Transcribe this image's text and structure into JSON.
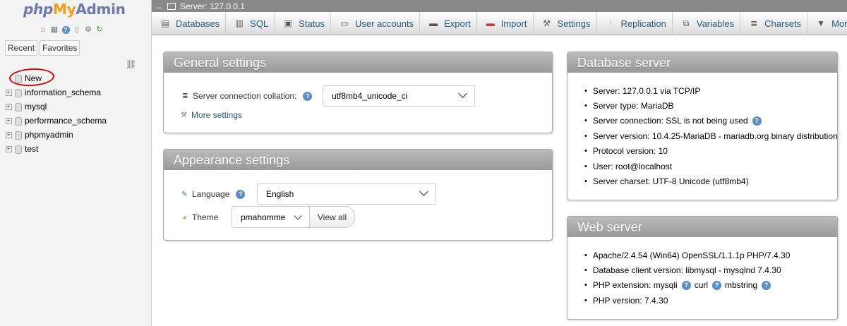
{
  "nav": {
    "logo": {
      "php": "php",
      "my": "My",
      "admin": "Admin"
    },
    "quick_icons": [
      "home-icon",
      "logout-icon",
      "help-icon",
      "docs-icon",
      "settings-icon",
      "reload-icon"
    ],
    "tabs": {
      "recent": "Recent",
      "favorites": "Favorites"
    },
    "tree": [
      {
        "name": "New",
        "new": true
      },
      {
        "name": "information_schema"
      },
      {
        "name": "mysql"
      },
      {
        "name": "performance_schema"
      },
      {
        "name": "phpmyadmin"
      },
      {
        "name": "test"
      }
    ]
  },
  "topbar": {
    "server_label": "Server: 127.0.0.1"
  },
  "menu": {
    "tabs": [
      {
        "label": "Databases",
        "icon": "database-icon"
      },
      {
        "label": "SQL",
        "icon": "sql-icon"
      },
      {
        "label": "Status",
        "icon": "status-icon"
      },
      {
        "label": "User accounts",
        "icon": "users-icon"
      },
      {
        "label": "Export",
        "icon": "export-icon"
      },
      {
        "label": "Import",
        "icon": "import-icon"
      },
      {
        "label": "Settings",
        "icon": "wrench-icon"
      },
      {
        "label": "Replication",
        "icon": "replication-icon"
      },
      {
        "label": "Variables",
        "icon": "variables-icon"
      },
      {
        "label": "Charsets",
        "icon": "charsets-icon"
      },
      {
        "label": "More",
        "icon": "chevron-down-icon"
      }
    ]
  },
  "general": {
    "title": "General settings",
    "collation_label": "Server connection collation:",
    "collation_value": "utf8mb4_unicode_ci",
    "more_settings": "More settings"
  },
  "appearance": {
    "title": "Appearance settings",
    "language_label": "Language",
    "language_value": "English",
    "theme_label": "Theme",
    "theme_value": "pmahomme",
    "view_all": "View all"
  },
  "db_server": {
    "title": "Database server",
    "items": [
      "Server: 127.0.0.1 via TCP/IP",
      "Server type: MariaDB",
      "Server connection: SSL is not being used",
      "Server version: 10.4.25-MariaDB - mariadb.org binary distribution",
      "Protocol version: 10",
      "User: root@localhost",
      "Server charset: UTF-8 Unicode (utf8mb4)"
    ]
  },
  "web_server": {
    "title": "Web server",
    "items": [
      "Apache/2.4.54 (Win64) OpenSSL/1.1.1p PHP/7.4.30",
      "Database client version: libmysql - mysqlnd 7.4.30"
    ],
    "php_ext_label": "PHP extension: mysqli",
    "php_ext_curl": "curl",
    "php_ext_mbstring": "mbstring",
    "php_version": "PHP version: 7.4.30"
  },
  "colors": {
    "link": "#235a81",
    "annotation": "#d20a0a",
    "panel_header": "#999999"
  }
}
